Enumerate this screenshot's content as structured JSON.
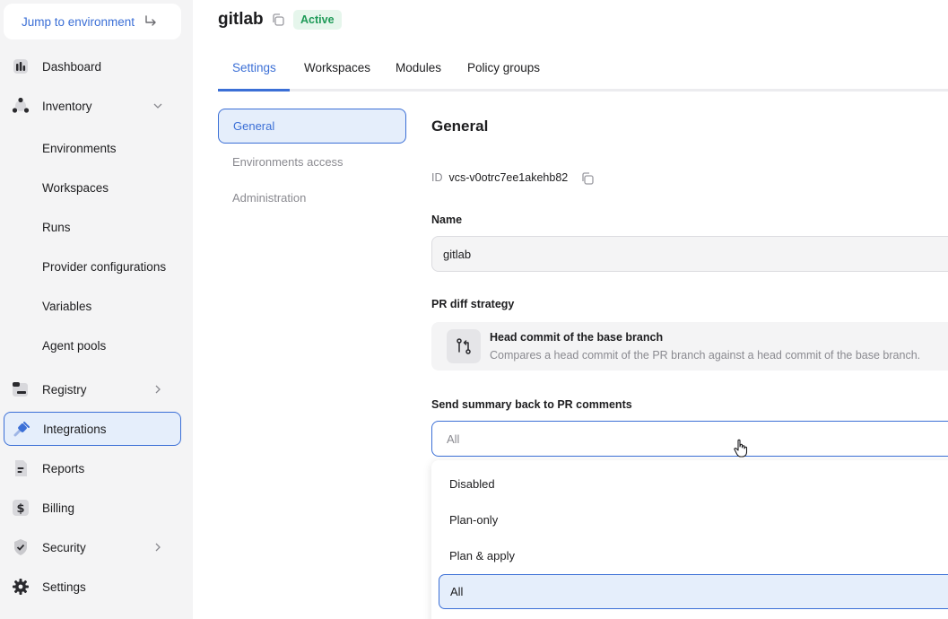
{
  "sidebar": {
    "jump_label": "Jump to environment",
    "items": [
      {
        "label": "Dashboard",
        "icon": "dashboard-icon"
      },
      {
        "label": "Inventory",
        "icon": "inventory-icon"
      },
      {
        "label": "Registry",
        "icon": "registry-icon"
      },
      {
        "label": "Integrations",
        "icon": "integrations-icon"
      },
      {
        "label": "Reports",
        "icon": "reports-icon"
      },
      {
        "label": "Billing",
        "icon": "billing-icon"
      },
      {
        "label": "Security",
        "icon": "shield-icon"
      },
      {
        "label": "Settings",
        "icon": "gear-icon"
      }
    ],
    "inventory_children": [
      "Environments",
      "Workspaces",
      "Runs",
      "Provider configurations",
      "Variables",
      "Agent pools"
    ],
    "active": "Integrations"
  },
  "header": {
    "title": "gitlab",
    "status": "Active"
  },
  "tabs": [
    "Settings",
    "Workspaces",
    "Modules",
    "Policy groups"
  ],
  "active_tab": "Settings",
  "subnav": [
    "General",
    "Environments access",
    "Administration"
  ],
  "general": {
    "section_title": "General",
    "id_label": "ID",
    "id_value": "vcs-v0otrc7ee1akehb82",
    "name_label": "Name",
    "name_value": "gitlab",
    "pr_diff_label": "PR diff strategy",
    "pr_diff_title": "Head commit of the base branch",
    "pr_diff_desc": "Compares a head commit of the PR branch against a head commit of the base branch.",
    "summary_label": "Send summary back to PR comments",
    "summary_value": "All",
    "options": [
      "Disabled",
      "Plan-only",
      "Plan & apply",
      "All"
    ],
    "selected_option": "All"
  },
  "colors": {
    "accent": "#3b6fd6",
    "active_bg": "#e5eefb",
    "badge_green": "#1e9a57"
  }
}
